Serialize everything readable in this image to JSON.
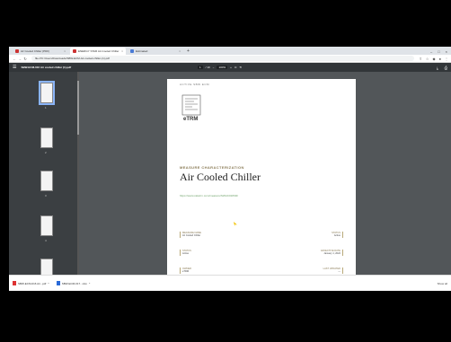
{
  "tabs": [
    {
      "label": "Air Cooled Chiller (PDF)",
      "active": false
    },
    {
      "label": "ENERGY STAR Air-Cooled Chiller",
      "active": true
    },
    {
      "label": "Estimated",
      "active": false
    }
  ],
  "address": {
    "url": "file:///C:/Users/Downloads/SBW-ECM-Air-cooled-chiller-(1).pdf"
  },
  "pdf": {
    "filename": "SBW-ECM-016 Air cooled chiller (1).pdf",
    "page": "1",
    "page_total": "/ 10",
    "zoom": "100%"
  },
  "thumbnails": [
    "1",
    "2",
    "3",
    "4",
    "5"
  ],
  "document": {
    "eyebrow": "ACTIVE SBW ECM",
    "logo_text": "eTRM",
    "section_label": "MEASURE CHARACTERIZATION",
    "title": "Air Cooled Chiller",
    "link": "https://www.caletrm.com/measure/SWHC018/02/",
    "meta": [
      {
        "k": "MEASURE NAME",
        "v": "Air Cooled Chiller"
      },
      {
        "k": "STATUS",
        "v": "Active"
      },
      {
        "k": "STATUS",
        "v": "Active"
      },
      {
        "k": "EFFECTIVE DATE",
        "v": "January 1, 2022"
      },
      {
        "k": "OWNER",
        "v": "eTRM"
      },
      {
        "k": "LAST UPDATED",
        "v": "—"
      }
    ]
  },
  "downloads": [
    {
      "name": "SBW-ECM-016 Air...pdf"
    },
    {
      "name": "SBW-ECM-017...xlsx"
    }
  ],
  "show_all": "Show all"
}
